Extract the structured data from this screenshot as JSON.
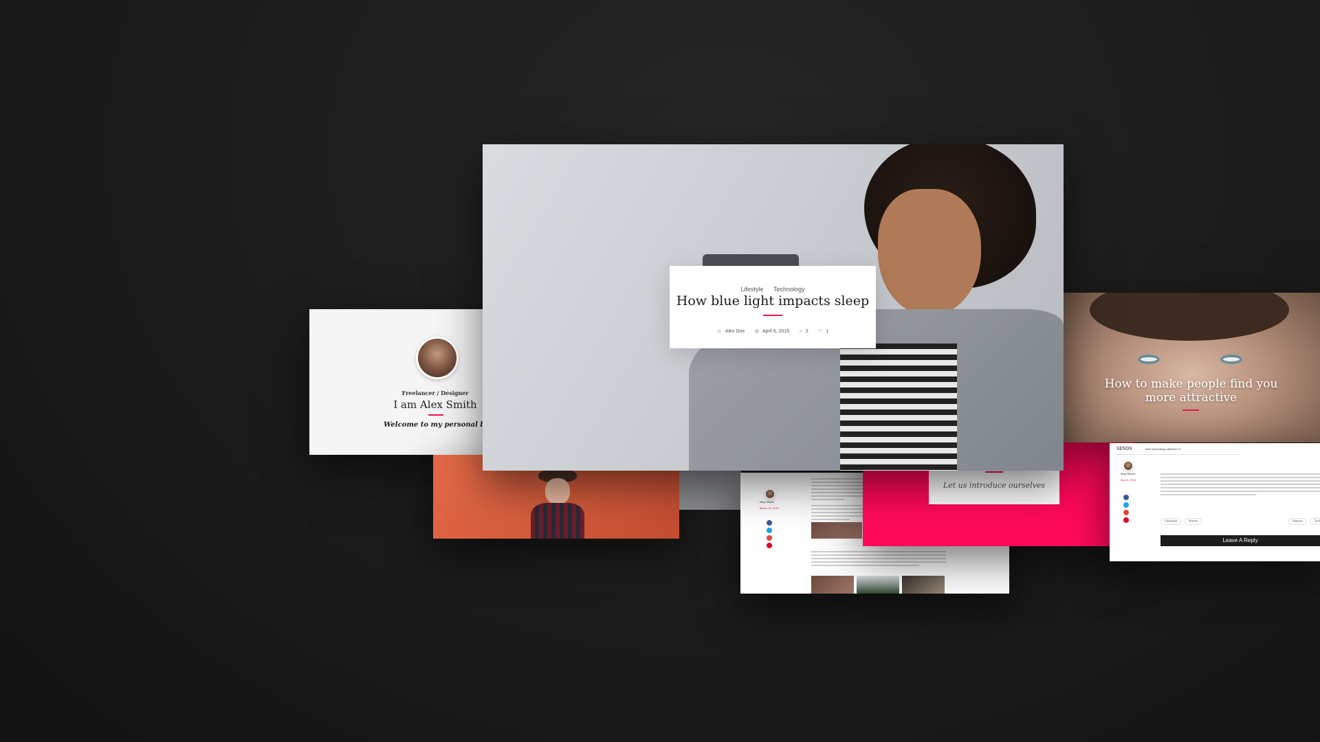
{
  "about": {
    "role": "Freelancer / Designer",
    "name": "I am Alex Smith",
    "welcome": "Welcome to my personal blog pa"
  },
  "featured": {
    "tags": [
      "Lifestyle",
      "Technology"
    ],
    "title": "How blue light impacts sleep",
    "author": "Alex Doe",
    "date": "April 6, 2016",
    "comments": "3",
    "likes": "1"
  },
  "hero2": {
    "title_line1": "How to make people find you",
    "title_line2": "more attractive"
  },
  "pink": {
    "intro": "Let us introduce ourselves"
  },
  "doc": {
    "author": "Mary Martin",
    "date": "March 29, 2016"
  },
  "rightdoc": {
    "logo": "SENDS",
    "menu_text": "New fascinating collection 'N'",
    "author": "Mary Martin",
    "date": "April 6, 2016",
    "reply_button": "Leave A Reply",
    "pills_left": [
      "Lifestyle",
      "Home"
    ],
    "pills_right": [
      "Nature",
      "Technology"
    ]
  },
  "colors": {
    "accent": "#e8174f",
    "pink_panel": "#ff0a5a",
    "background": "#1a1a1a"
  },
  "icons": [
    "user-icon",
    "clock-icon",
    "comment-icon",
    "heart-icon",
    "facebook-icon",
    "twitter-icon",
    "google-plus-icon",
    "pinterest-icon"
  ]
}
